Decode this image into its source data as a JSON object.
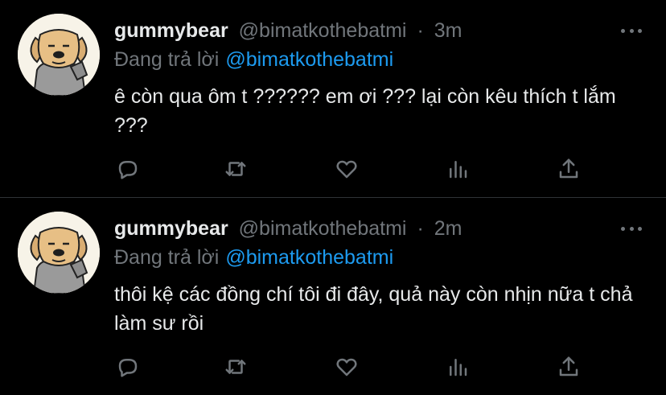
{
  "tweets": [
    {
      "display_name": "gummybear",
      "handle": "@bimatkothebatmi",
      "separator": "·",
      "time": "3m",
      "reply_prefix": "Đang trả lời",
      "reply_mention": "@bimatkothebatmi",
      "text": "ê còn qua ôm t ?????? em ơi ??? lại còn kêu thích t lắm ???"
    },
    {
      "display_name": "gummybear",
      "handle": "@bimatkothebatmi",
      "separator": "·",
      "time": "2m",
      "reply_prefix": "Đang trả lời",
      "reply_mention": "@bimatkothebatmi",
      "text": "thôi kệ các đồng chí tôi đi đây, quả này còn nhịn nữa t chả làm sư rồi"
    }
  ],
  "icons": {
    "reply": "reply-icon",
    "retweet": "retweet-icon",
    "like": "heart-icon",
    "analytics": "analytics-icon",
    "share": "share-icon",
    "more": "more-icon"
  },
  "colors": {
    "background": "#000000",
    "text": "#e7e9ea",
    "muted": "#71767b",
    "accent": "#1d9bf0",
    "divider": "#2f3336"
  }
}
